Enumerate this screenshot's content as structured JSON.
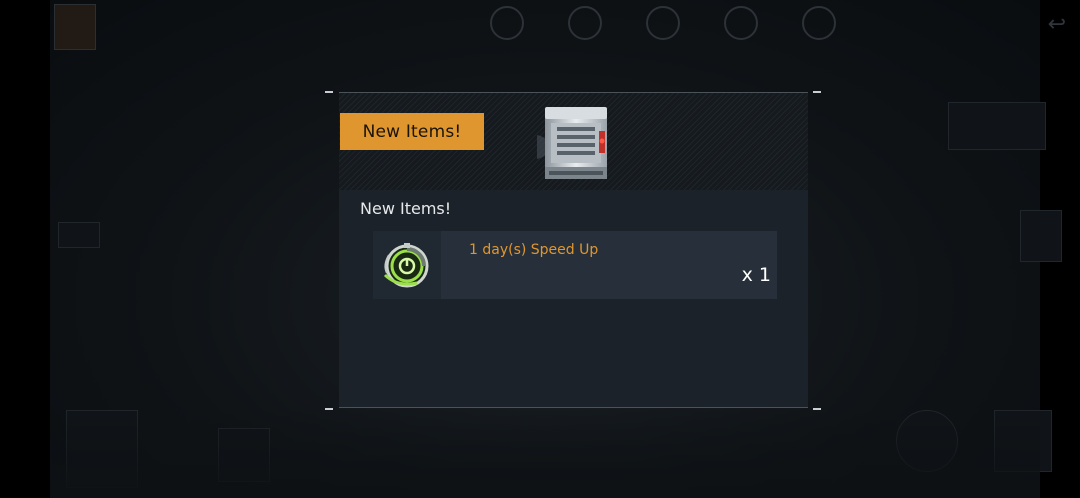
{
  "dialog": {
    "tag_label": "New Items!",
    "subtitle": "New Items!",
    "items": [
      {
        "name": "1 day(s) Speed Up",
        "quantity": "x 1",
        "icon": "speed-up-clock-icon"
      }
    ],
    "header_icon": "supply-crate-icon"
  },
  "colors": {
    "accent": "#e0962e",
    "dialog_bg": "#1c2229",
    "item_row_bg": "#27303a",
    "icon_green": "#9be04a"
  }
}
